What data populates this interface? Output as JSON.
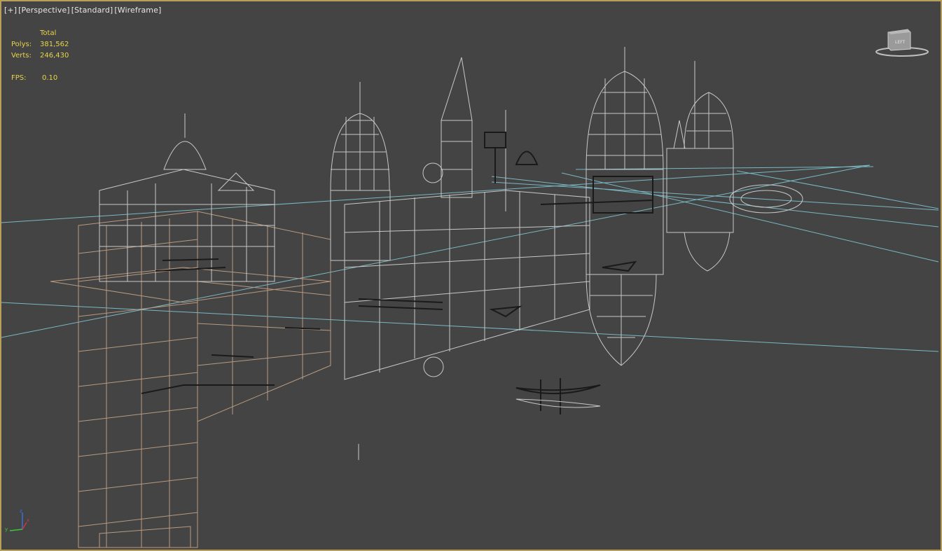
{
  "viewport": {
    "label": {
      "plus": "[+]",
      "view": "[Perspective]",
      "shading_mode": "[Standard]",
      "display_mode": "[Wireframe]"
    },
    "stats": {
      "header": "Total",
      "polys_label": "Polys:",
      "polys_value": "381,562",
      "verts_label": "Verts:",
      "verts_value": "246,430",
      "fps_label": "FPS:",
      "fps_value": "0.10"
    },
    "viewcube": {
      "face_label": "LEFT"
    },
    "axis": {
      "x": "x",
      "y": "y",
      "z": "z"
    },
    "colors": {
      "background": "#444444",
      "border": "#b8a05a",
      "stats_text": "#e8d44a",
      "wire_tan": "#b89a80",
      "wire_grey": "#c8c8c8",
      "wire_dark": "#1a1a1a",
      "grid_cyan": "#79b8c4"
    }
  }
}
